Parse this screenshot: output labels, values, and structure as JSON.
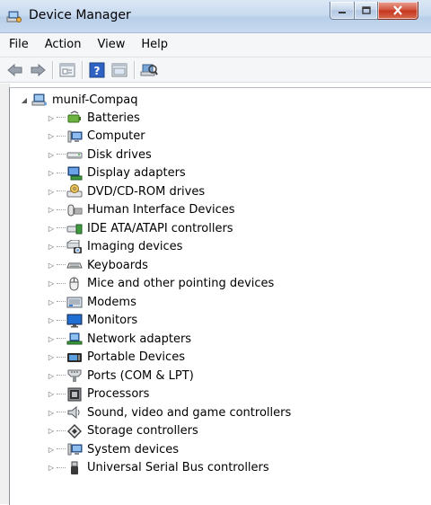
{
  "window": {
    "title": "Device Manager",
    "title_icon": "device-manager-icon"
  },
  "menu": [
    "File",
    "Action",
    "View",
    "Help"
  ],
  "toolbar": [
    "back-arrow-icon",
    "forward-arrow-icon",
    "properties-icon",
    "help-icon",
    "update-driver-icon",
    "scan-hardware-icon"
  ],
  "tree": {
    "root": {
      "label": "munif-Compaq",
      "icon": "computer-icon",
      "expanded": true
    },
    "items": [
      {
        "label": "Batteries",
        "icon": "battery-icon"
      },
      {
        "label": "Computer",
        "icon": "computer-icon"
      },
      {
        "label": "Disk drives",
        "icon": "disk-drive-icon"
      },
      {
        "label": "Display adapters",
        "icon": "display-adapter-icon"
      },
      {
        "label": "DVD/CD-ROM drives",
        "icon": "dvd-drive-icon"
      },
      {
        "label": "Human Interface Devices",
        "icon": "hid-icon"
      },
      {
        "label": "IDE ATA/ATAPI controllers",
        "icon": "ide-controller-icon"
      },
      {
        "label": "Imaging devices",
        "icon": "imaging-device-icon"
      },
      {
        "label": "Keyboards",
        "icon": "keyboard-icon"
      },
      {
        "label": "Mice and other pointing devices",
        "icon": "mouse-icon"
      },
      {
        "label": "Modems",
        "icon": "modem-icon"
      },
      {
        "label": "Monitors",
        "icon": "monitor-icon"
      },
      {
        "label": "Network adapters",
        "icon": "network-adapter-icon"
      },
      {
        "label": "Portable Devices",
        "icon": "portable-device-icon"
      },
      {
        "label": "Ports (COM & LPT)",
        "icon": "port-icon"
      },
      {
        "label": "Processors",
        "icon": "processor-icon"
      },
      {
        "label": "Sound, video and game controllers",
        "icon": "sound-icon"
      },
      {
        "label": "Storage controllers",
        "icon": "storage-controller-icon"
      },
      {
        "label": "System devices",
        "icon": "system-device-icon"
      },
      {
        "label": "Universal Serial Bus controllers",
        "icon": "usb-icon"
      }
    ]
  },
  "colors": {
    "titlebar": "#c9dbf0",
    "close_button": "#c4331d",
    "menubar": "#f5f6f8"
  }
}
